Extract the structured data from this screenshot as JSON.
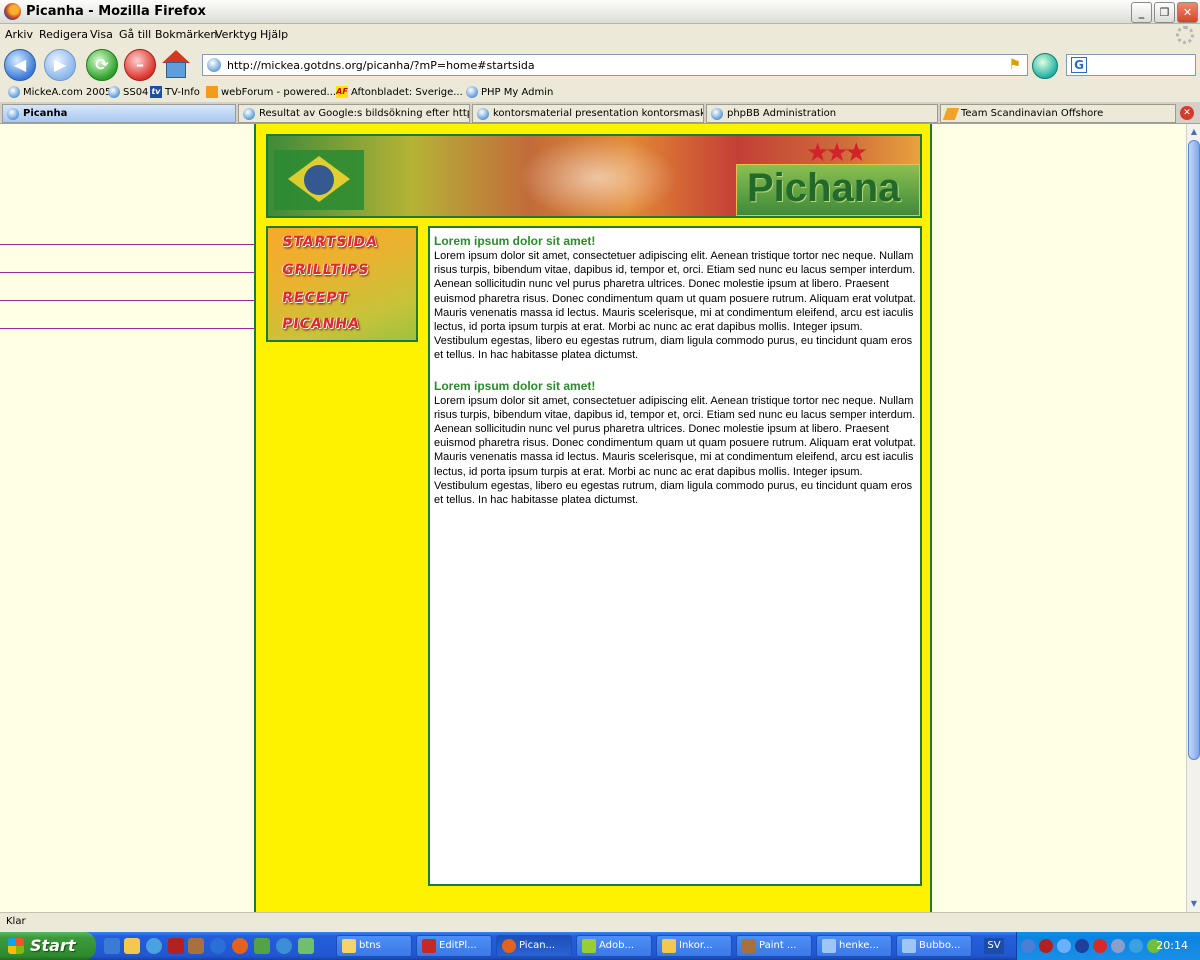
{
  "window": {
    "title": "Picanha - Mozilla Firefox"
  },
  "menubar": [
    "Arkiv",
    "Redigera",
    "Visa",
    "Gå till",
    "Bokmärken",
    "Verktyg",
    "Hjälp"
  ],
  "navigation": {
    "url": "http://mickea.gotdns.org/picanha/?mP=home#startsida",
    "search_value": ""
  },
  "bookmarks": [
    {
      "label": "MickeA.com 2005",
      "icon": "bulb-icon"
    },
    {
      "label": "SS04",
      "icon": "bulb-icon"
    },
    {
      "label": "TV-Info",
      "icon": "tv-icon"
    },
    {
      "label": "webForum - powered...",
      "icon": "webforum-icon"
    },
    {
      "label": "Aftonbladet: Sverige...",
      "icon": "aftonbladet-icon"
    },
    {
      "label": "PHP My Admin",
      "icon": "bulb-icon"
    }
  ],
  "tabs": [
    {
      "label": "Picanha",
      "active": true
    },
    {
      "label": "Resultat av Google:s bildsökning efter http:...",
      "active": false
    },
    {
      "label": "kontorsmaterial presentation kontorsmaskin...",
      "active": false
    },
    {
      "label": "phpBB Administration",
      "active": false
    },
    {
      "label": "Team Scandinavian Offshore",
      "active": false
    }
  ],
  "site": {
    "logo": "Pichana",
    "menu": [
      "STARTSIDA",
      "GRILLTIPS",
      "RECEPT",
      "PICANHA"
    ],
    "articles": [
      {
        "title": "Lorem ipsum dolor sit amet!",
        "body": "Lorem ipsum dolor sit amet, consectetuer adipiscing elit. Aenean tristique tortor nec neque. Nullam risus turpis, bibendum vitae, dapibus id, tempor et, orci. Etiam sed nunc eu lacus semper interdum. Aenean sollicitudin nunc vel purus pharetra ultrices. Donec molestie ipsum at libero. Praesent euismod pharetra risus. Donec condimentum quam ut quam posuere rutrum. Aliquam erat volutpat. Mauris venenatis massa id lectus. Mauris scelerisque, mi at condimentum eleifend, arcu est iaculis lectus, id porta ipsum turpis at erat. Morbi ac nunc ac erat dapibus mollis. Integer ipsum. Vestibulum egestas, libero eu egestas rutrum, diam ligula commodo purus, eu tincidunt quam eros et tellus. In hac habitasse platea dictumst."
      },
      {
        "title": "Lorem ipsum dolor sit amet!",
        "body": "Lorem ipsum dolor sit amet, consectetuer adipiscing elit. Aenean tristique tortor nec neque. Nullam risus turpis, bibendum vitae, dapibus id, tempor et, orci. Etiam sed nunc eu lacus semper interdum. Aenean sollicitudin nunc vel purus pharetra ultrices. Donec molestie ipsum at libero. Praesent euismod pharetra risus. Donec condimentum quam ut quam posuere rutrum. Aliquam erat volutpat. Mauris venenatis massa id lectus. Mauris scelerisque, mi at condimentum eleifend, arcu est iaculis lectus, id porta ipsum turpis at erat. Morbi ac nunc ac erat dapibus mollis. Integer ipsum. Vestibulum egestas, libero eu egestas rutrum, diam ligula commodo purus, eu tincidunt quam eros et tellus. In hac habitasse platea dictumst."
      }
    ]
  },
  "status": "Klar",
  "taskbar": {
    "start_label": "Start",
    "tasks": [
      "btns",
      "EditPl...",
      "Pican...",
      "Adob...",
      "Inkor...",
      "Paint ...",
      "henke...",
      "Bubbo..."
    ],
    "language": "SV",
    "clock": "20:14"
  },
  "colors": {
    "page_bg": "#fff200",
    "border_green": "#1f7a33",
    "heading_green": "#2e8a2e",
    "menu_red": "#e0292a",
    "outer_bg": "#ffffe5"
  }
}
